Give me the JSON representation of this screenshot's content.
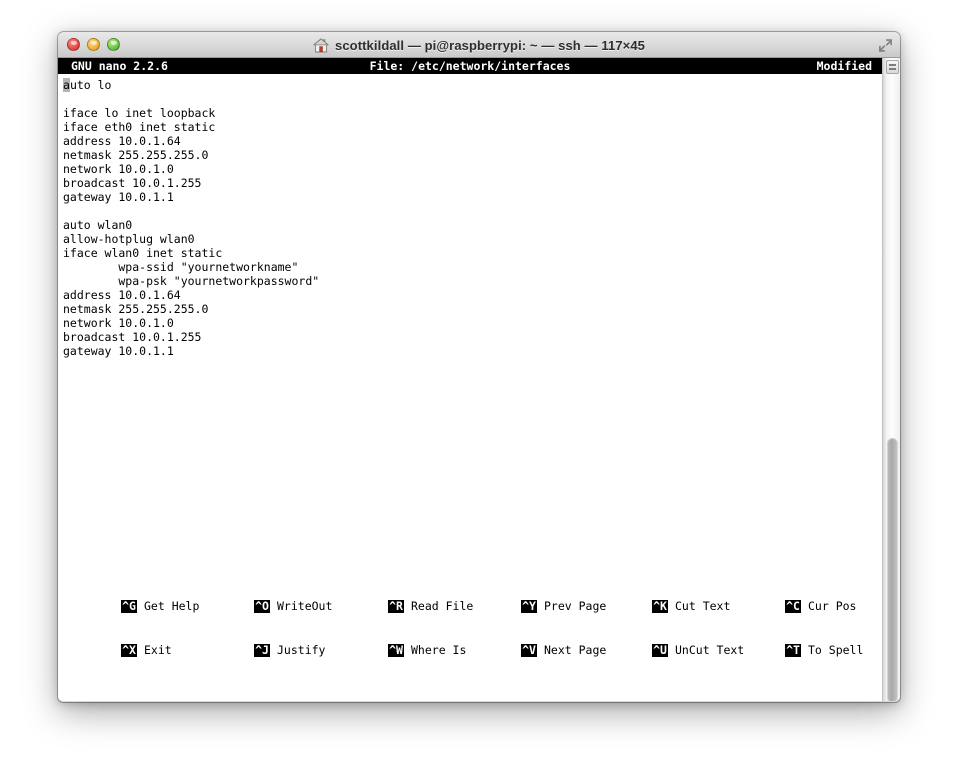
{
  "window": {
    "title": "scottkildall — pi@raspberrypi: ~ — ssh — 117×45",
    "home_icon": "home-icon",
    "controls": {
      "close": "close-button",
      "minimize": "minimize-button",
      "zoom": "zoom-button",
      "fullscreen": "fullscreen-button"
    }
  },
  "nano": {
    "version_label": "GNU nano 2.2.6",
    "file_label": "File: /etc/network/interfaces",
    "modified_label": "Modified",
    "lines": [
      "auto lo",
      "",
      "iface lo inet loopback",
      "iface eth0 inet static",
      "address 10.0.1.64",
      "netmask 255.255.255.0",
      "network 10.0.1.0",
      "broadcast 10.0.1.255",
      "gateway 10.0.1.1",
      "",
      "auto wlan0",
      "allow-hotplug wlan0",
      "iface wlan0 inet static",
      "        wpa-ssid \"yournetworkname\"",
      "        wpa-psk \"yournetworkpassword\"",
      "address 10.0.1.64",
      "netmask 255.255.255.0",
      "network 10.0.1.0",
      "broadcast 10.0.1.255",
      "gateway 10.0.1.1"
    ],
    "cursor": {
      "line": 0,
      "column": 0,
      "char": "a"
    },
    "shortcuts_row1": [
      {
        "key": "^G",
        "label": "Get Help"
      },
      {
        "key": "^O",
        "label": "WriteOut"
      },
      {
        "key": "^R",
        "label": "Read File"
      },
      {
        "key": "^Y",
        "label": "Prev Page"
      },
      {
        "key": "^K",
        "label": "Cut Text"
      },
      {
        "key": "^C",
        "label": "Cur Pos"
      }
    ],
    "shortcuts_row2": [
      {
        "key": "^X",
        "label": "Exit"
      },
      {
        "key": "^J",
        "label": "Justify"
      },
      {
        "key": "^W",
        "label": "Where Is"
      },
      {
        "key": "^V",
        "label": "Next Page"
      },
      {
        "key": "^U",
        "label": "UnCut Text"
      },
      {
        "key": "^T",
        "label": "To Spell"
      }
    ]
  },
  "colors": {
    "terminal_bg": "#ffffff",
    "terminal_fg": "#000000",
    "status_bg": "#000000",
    "status_fg": "#ffffff",
    "cursor_bg": "#b4b4b4"
  }
}
